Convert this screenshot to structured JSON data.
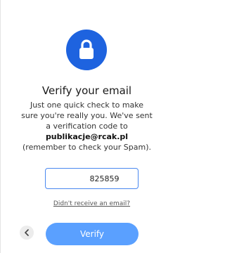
{
  "theme": {
    "accent": "#1e63df",
    "button": "#5aa0ff",
    "input_border": "#4a88f0"
  },
  "header": {
    "icon": "lock-icon",
    "title": "Verify your email"
  },
  "description": {
    "line1": "Just one quick check to make",
    "line2": "sure you're really you. We've sent",
    "line3": "a verification code to",
    "email": "publikacje@rcak.pl",
    "line5": "(remember to check your Spam)."
  },
  "code_field": {
    "value": "825859"
  },
  "resend_link": "Didn't receive an email?",
  "actions": {
    "back_icon": "chevron-left-icon",
    "verify_label": "Verify"
  }
}
